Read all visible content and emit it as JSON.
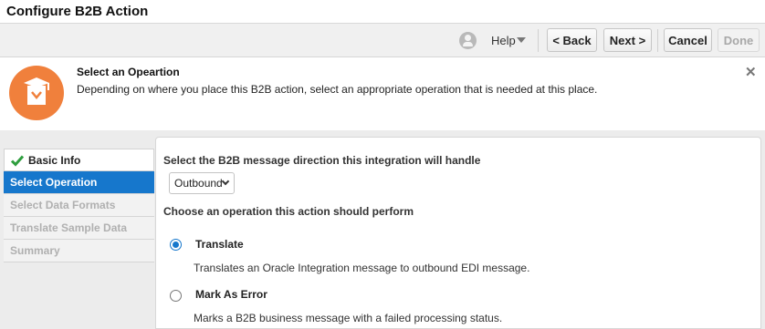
{
  "window": {
    "title": "Configure B2B Action"
  },
  "toolbar": {
    "help_label": "Help",
    "back_label": "< Back",
    "next_label": "Next >",
    "cancel_label": "Cancel",
    "done_label": "Done"
  },
  "banner": {
    "heading": "Select an Opeartion",
    "text": "Depending on where you place this B2B action, select an appropriate operation that is needed at this place."
  },
  "nav": {
    "items": [
      {
        "label": "Basic Info",
        "state": "done"
      },
      {
        "label": "Select Operation",
        "state": "active"
      },
      {
        "label": "Select Data Formats",
        "state": "disabled"
      },
      {
        "label": "Translate Sample Data",
        "state": "disabled"
      },
      {
        "label": "Summary",
        "state": "disabled"
      }
    ]
  },
  "main": {
    "direction_question": "Select the B2B message direction this integration will handle",
    "direction_value": "Outbound",
    "operation_question": "Choose an operation this action should perform",
    "options": [
      {
        "label": "Translate",
        "description": "Translates an Oracle Integration message to outbound EDI message.",
        "selected": true
      },
      {
        "label": "Mark As Error",
        "description": "Marks a B2B business message with a failed processing status.",
        "selected": false
      }
    ]
  },
  "colors": {
    "accent": "#1677cc",
    "banner_icon": "#f0803c",
    "check": "#2e9e3e"
  }
}
